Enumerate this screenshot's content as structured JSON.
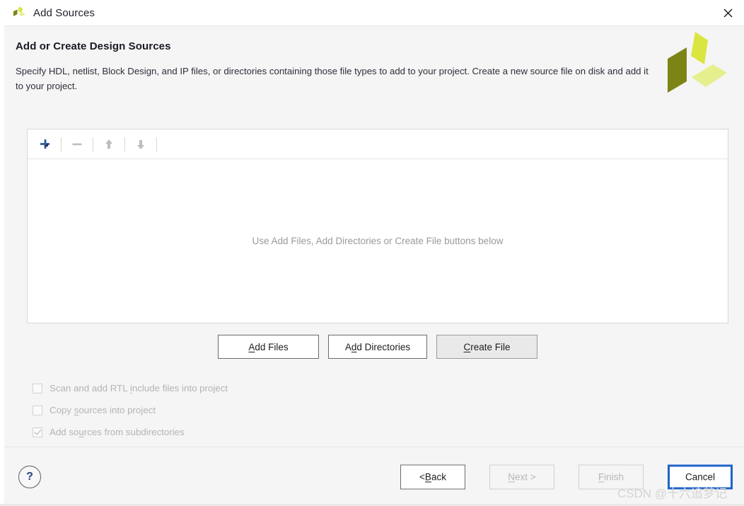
{
  "window": {
    "title": "Add Sources",
    "icon": "vivado-logo-icon",
    "close_label": "✕"
  },
  "header": {
    "title": "Add or Create Design Sources",
    "description": "Specify HDL, netlist, Block Design, and IP files, or directories containing those file types to add to your project. Create a new source file on disk and add it to your project.",
    "logo": "xilinx-vivado-logo"
  },
  "list_panel": {
    "toolbar": {
      "add_icon": "plus-icon",
      "remove_icon": "minus-icon",
      "move_up_icon": "arrow-up-icon",
      "move_down_icon": "arrow-down-icon"
    },
    "empty_message": "Use Add Files, Add Directories or Create File buttons below",
    "rows": []
  },
  "actions": [
    {
      "label_pre": "",
      "accel": "A",
      "label_post": "dd Files",
      "state": "enabled",
      "name": "add-files-button"
    },
    {
      "label_pre": "A",
      "accel": "d",
      "label_post": "d Directories",
      "state": "enabled",
      "name": "add-directories-button"
    },
    {
      "label_pre": "",
      "accel": "C",
      "label_post": "reate File",
      "state": "hover",
      "name": "create-file-button"
    }
  ],
  "options": [
    {
      "label_pre": "Scan and add RTL ",
      "accel": "i",
      "label_post": "nclude files into project",
      "checked": false,
      "enabled": false,
      "name": "scan-rtl-include-checkbox"
    },
    {
      "label_pre": "Copy ",
      "accel": "s",
      "label_post": "ources into project",
      "checked": false,
      "enabled": false,
      "name": "copy-sources-checkbox"
    },
    {
      "label_pre": "Add so",
      "accel": "u",
      "label_post": "rces from subdirectories",
      "checked": true,
      "enabled": false,
      "name": "add-subdirectories-checkbox"
    }
  ],
  "footer": {
    "help_label": "?",
    "nav": [
      {
        "label_pre": "< ",
        "accel": "B",
        "label_post": "ack",
        "state": "enabled",
        "name": "back-button"
      },
      {
        "label_pre": "",
        "accel": "N",
        "label_post": "ext >",
        "state": "disabled",
        "name": "next-button"
      },
      {
        "label_pre": "",
        "accel": "F",
        "label_post": "inish",
        "state": "disabled",
        "name": "finish-button"
      },
      {
        "label_pre": "Cancel",
        "accel": "",
        "label_post": "",
        "state": "focused",
        "name": "cancel-button"
      }
    ],
    "watermark": "CSDN @十六追梦记"
  },
  "colors": {
    "accent_blue": "#1f63c8",
    "logo_dark": "#7d8416",
    "logo_bright": "#dbe53f",
    "logo_light": "#e6ef8d",
    "toolbar_plus": "#2d5aa0",
    "disabled_text": "#b4b4b4"
  }
}
